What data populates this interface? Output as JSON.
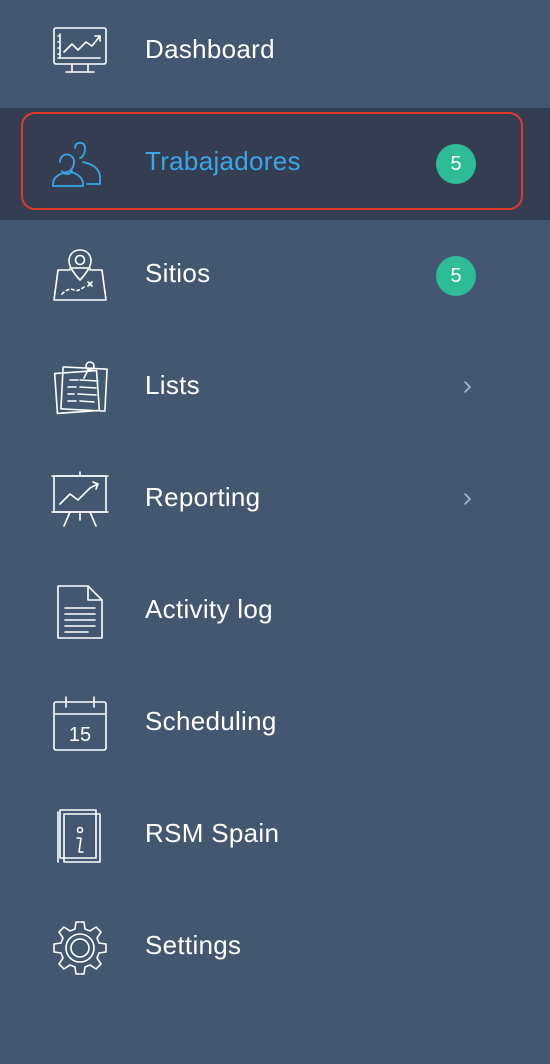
{
  "nav": {
    "items": [
      {
        "label": "Dashboard",
        "icon": "dashboard-monitor-icon",
        "active": false
      },
      {
        "label": "Trabajadores",
        "icon": "users-icon",
        "active": true,
        "badge": "5"
      },
      {
        "label": "Sitios",
        "icon": "map-pin-icon",
        "active": false,
        "badge": "5"
      },
      {
        "label": "Lists",
        "icon": "notes-icon",
        "active": false,
        "has_submenu": true
      },
      {
        "label": "Reporting",
        "icon": "presentation-chart-icon",
        "active": false,
        "has_submenu": true
      },
      {
        "label": "Activity log",
        "icon": "document-icon",
        "active": false
      },
      {
        "label": "Scheduling",
        "icon": "calendar-icon",
        "active": false,
        "calendar_day": "15"
      },
      {
        "label": "RSM Spain",
        "icon": "info-book-icon",
        "active": false
      },
      {
        "label": "Settings",
        "icon": "gear-icon",
        "active": false
      }
    ]
  },
  "colors": {
    "sidebar_bg": "#435870",
    "active_bg": "#353e50",
    "active_text": "#39a6e8",
    "active_border": "#e03a2f",
    "badge_bg": "#2ebc97",
    "text": "#ffffff"
  }
}
